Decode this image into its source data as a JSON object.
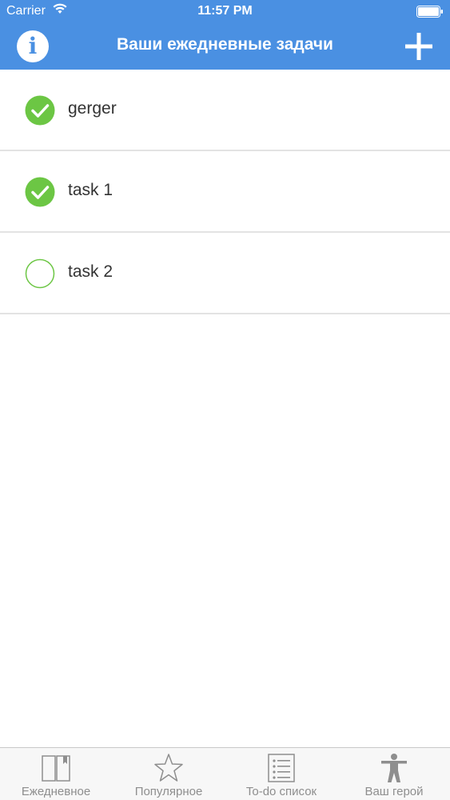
{
  "status_bar": {
    "carrier": "Carrier",
    "time": "11:57 PM"
  },
  "nav": {
    "title": "Ваши ежедневные задачи",
    "info_icon": "info-icon",
    "info_glyph": "i",
    "add_icon": "plus-icon"
  },
  "colors": {
    "accent": "#4a90e2",
    "check": "#6cc644",
    "divider": "#e3e3e3",
    "tab_text": "#8e8e8e"
  },
  "tasks": [
    {
      "label": "gerger",
      "done": true
    },
    {
      "label": "task 1",
      "done": true
    },
    {
      "label": "task 2",
      "done": false
    }
  ],
  "tabs": [
    {
      "label": "Ежедневное",
      "icon": "book-icon"
    },
    {
      "label": "Популярное",
      "icon": "star-icon"
    },
    {
      "label": "To-do список",
      "icon": "list-icon"
    },
    {
      "label": "Ваш герой",
      "icon": "person-icon"
    }
  ]
}
